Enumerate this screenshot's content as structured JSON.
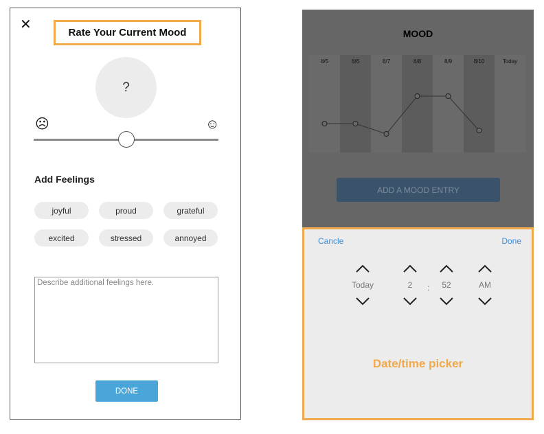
{
  "left": {
    "close_glyph": "✕",
    "title": "Rate Your Current Mood",
    "mood_value": "?",
    "sad_glyph": "☹",
    "happy_glyph": "☺",
    "slider_fraction": 0.5,
    "add_feelings_label": "Add Feelings",
    "feelings": [
      "joyful",
      "proud",
      "grateful",
      "excited",
      "stressed",
      "annoyed"
    ],
    "notes_placeholder": "Describe additional feelings here.",
    "done_label": "DONE"
  },
  "right": {
    "title": "MOOD",
    "days": [
      "8/5",
      "8/6",
      "8/7",
      "8/8",
      "8/9",
      "8/10",
      "Today"
    ],
    "mood_values": [
      0.3,
      0.3,
      0.15,
      0.7,
      0.7,
      0.2
    ],
    "add_entry_label": "ADD A MOOD ENTRY",
    "picker": {
      "cancel_label": "Cancle",
      "done_label": "Done",
      "day": "Today",
      "hour": "2",
      "separator": ":",
      "minute": "52",
      "ampm": "AM",
      "annotation": "Date/time picker"
    }
  },
  "colors": {
    "highlight": "#f0a94b",
    "button_blue": "#4aa6d8",
    "link_blue": "#3b8fd9"
  }
}
